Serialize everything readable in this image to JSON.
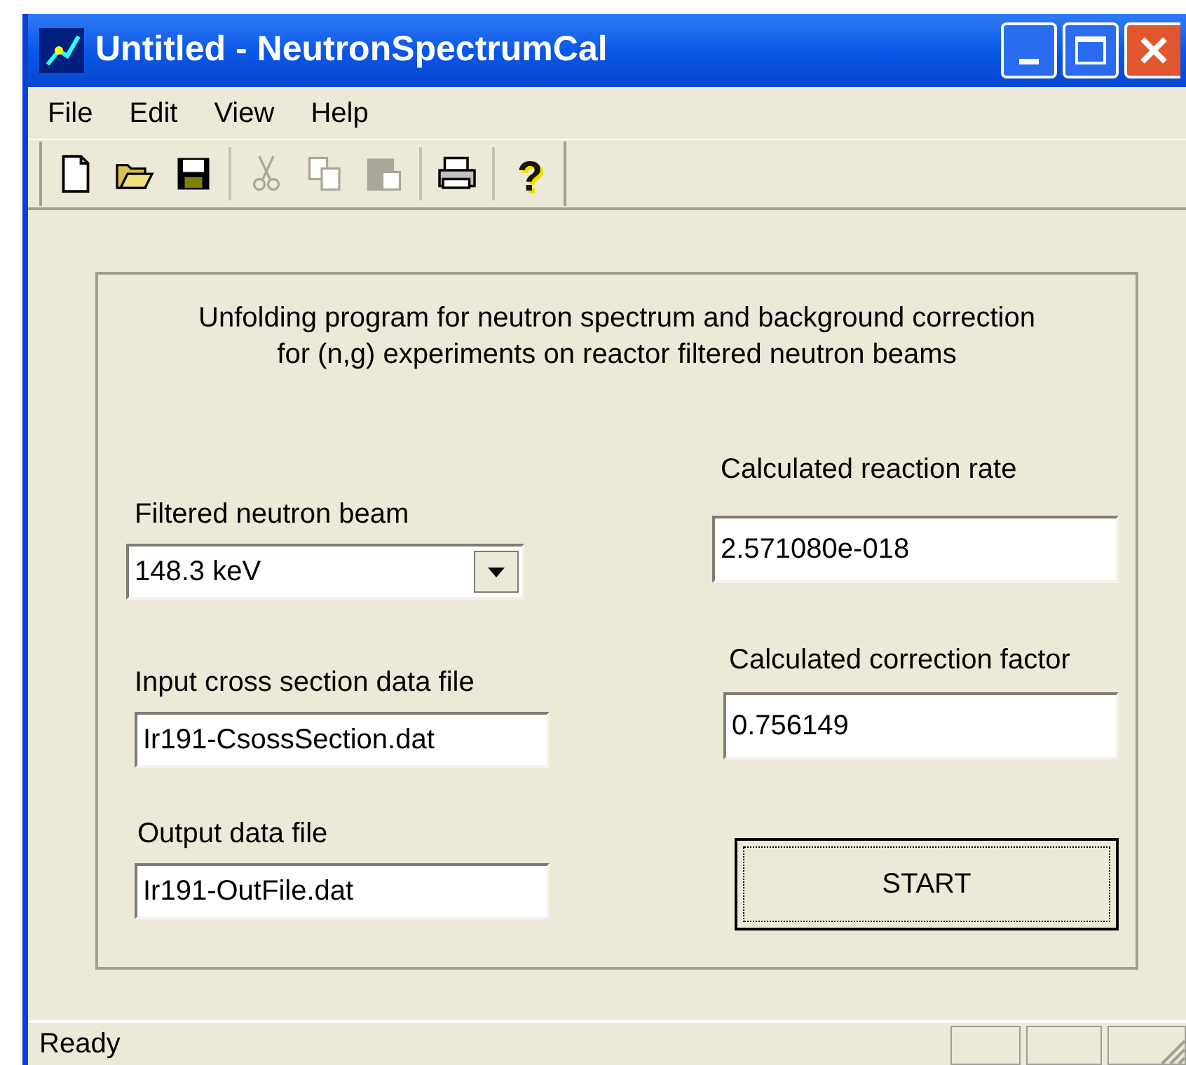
{
  "window": {
    "title": "Untitled - NeutronSpectrumCal"
  },
  "menu": [
    "File",
    "Edit",
    "View",
    "Help"
  ],
  "toolbar": [
    {
      "kind": "new",
      "disabled": false
    },
    {
      "kind": "open",
      "disabled": false
    },
    {
      "kind": "save",
      "disabled": false
    },
    {
      "kind": "separator"
    },
    {
      "kind": "cut",
      "disabled": true
    },
    {
      "kind": "copy",
      "disabled": true
    },
    {
      "kind": "paste",
      "disabled": true
    },
    {
      "kind": "separator"
    },
    {
      "kind": "print",
      "disabled": false
    },
    {
      "kind": "separator"
    },
    {
      "kind": "help",
      "glyph": "?",
      "disabled": false
    }
  ],
  "description": [
    "Unfolding program for neutron spectrum and background correction",
    "for (n,g) experiments on reactor filtered neutron beams"
  ],
  "beam": {
    "label": "Filtered neutron beam",
    "value": "148.3 keV"
  },
  "input_file": {
    "label": "Input cross section data file",
    "value": "Ir191-CsossSection.dat"
  },
  "output_file": {
    "label": "Output data file",
    "value": "Ir191-OutFile.dat"
  },
  "reaction_rate": {
    "label": "Calculated reaction rate",
    "value": "2.571080e-018"
  },
  "correction_factor": {
    "label": "Calculated correction factor",
    "value": "0.756149"
  },
  "start_button": "START",
  "status_bar": "Ready"
}
